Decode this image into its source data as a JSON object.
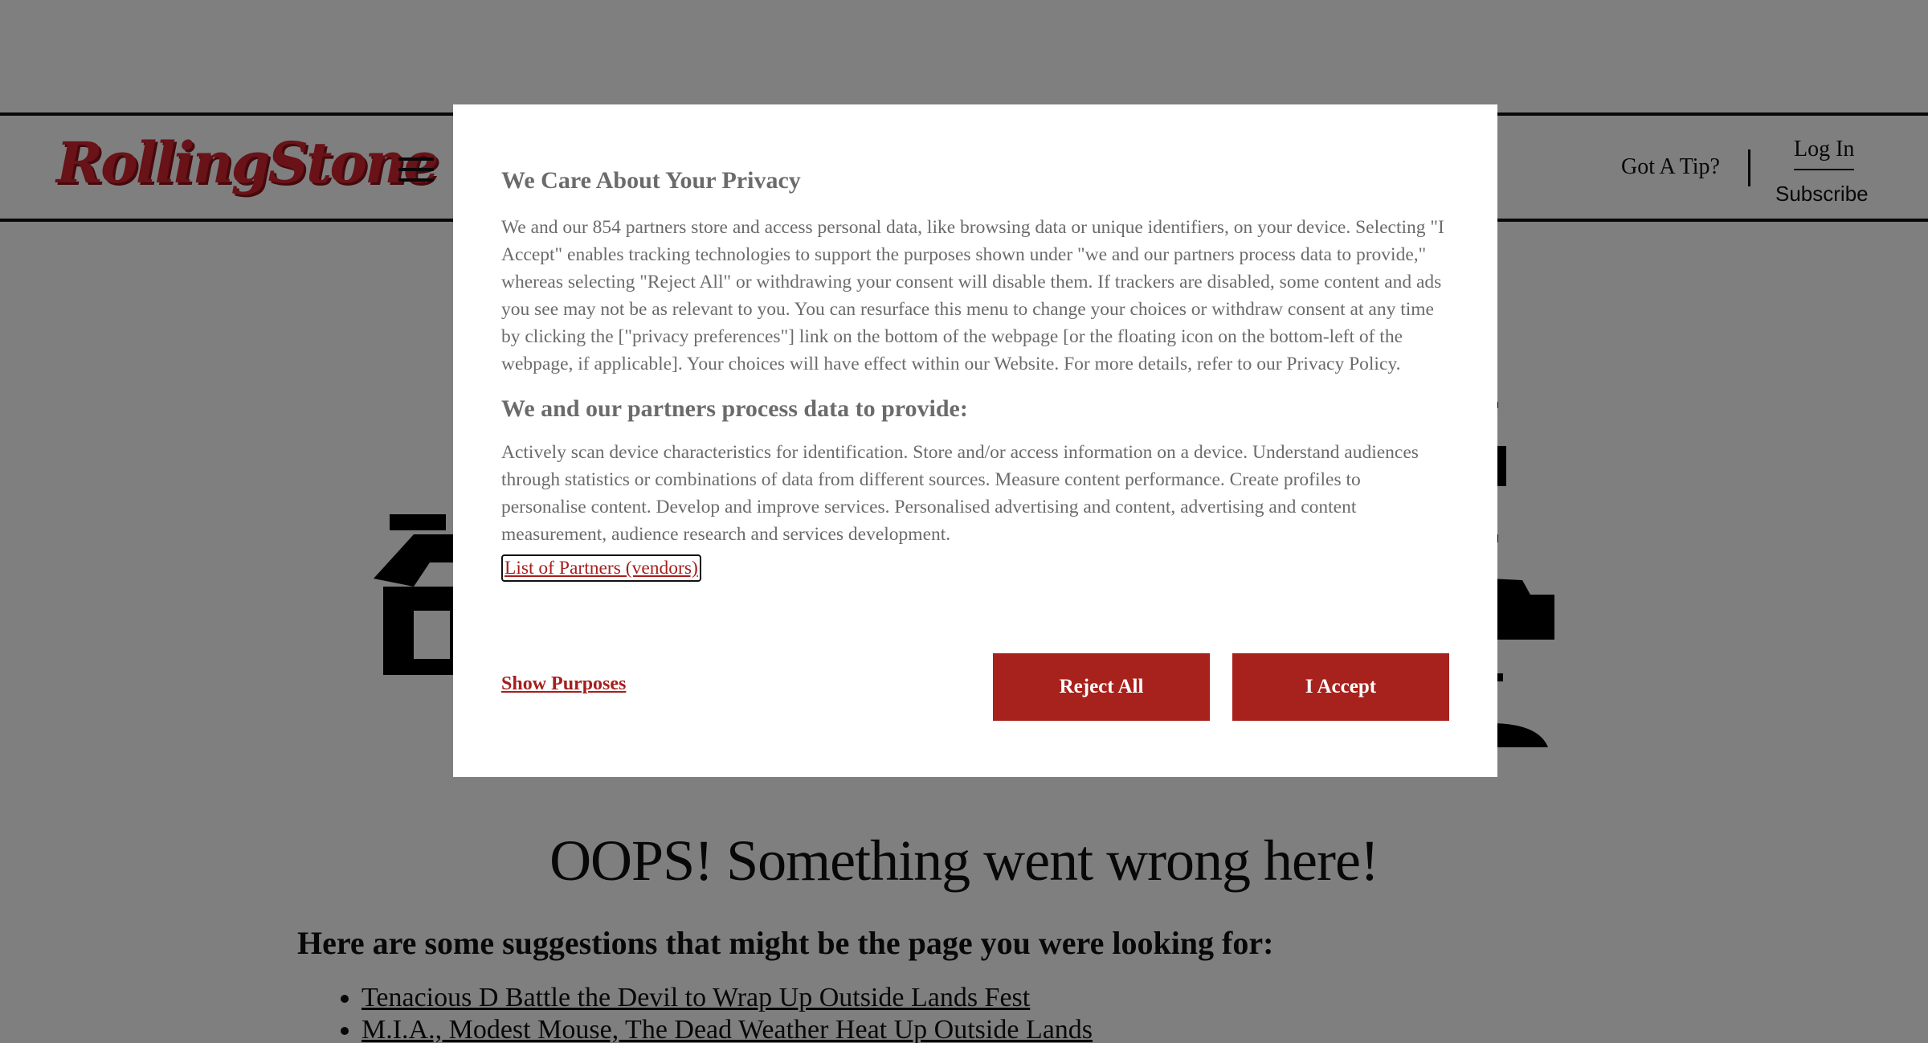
{
  "header": {
    "logo_text": "RollingStone",
    "tip_label": "Got A Tip?",
    "login_label": "Log In",
    "subscribe_label": "Subscribe"
  },
  "main": {
    "error_title": "OOPS! Something went wrong here!",
    "suggestions_heading": "Here are some suggestions that might be the page you were looking for:",
    "suggestions": [
      "Tenacious D Battle the Devil to Wrap Up Outside Lands Fest",
      "M.I.A., Modest Mouse, The Dead Weather Heat Up Outside Lands"
    ]
  },
  "consent": {
    "title": "We Care About Your Privacy",
    "body": "We and our 854 partners store and access personal data, like browsing data or unique identifiers, on your device. Selecting \"I Accept\" enables tracking technologies to support the purposes shown under \"we and our partners process data to provide,\" whereas selecting \"Reject All\" or withdrawing your consent will disable them. If trackers are disabled, some content and ads you see may not be as relevant to you. You can resurface this menu to change your choices or withdraw consent at any time by clicking the [\"privacy preferences\"] link on the bottom of the webpage [or the floating icon on the bottom-left of the webpage, if applicable]. Your choices will have effect within our Website. For more details, refer to our Privacy Policy.",
    "purposes_heading": "We and our partners process data to provide:",
    "purposes_body": "Actively scan device characteristics for identification. Store and/or access information on a device. Understand audiences through statistics or combinations of data from different sources. Measure content performance. Create profiles to personalise content. Develop and improve services. Personalised advertising and content, advertising and content measurement, audience research and services development.",
    "partners_link": "List of Partners (vendors)",
    "show_purposes_label": "Show Purposes",
    "reject_label": "Reject All",
    "accept_label": "I Accept"
  },
  "colors": {
    "brand_red": "#d32531",
    "button_red": "#a8221d",
    "link_red": "#a51f1e",
    "overlay": "rgba(0,0,0,0.5)"
  }
}
